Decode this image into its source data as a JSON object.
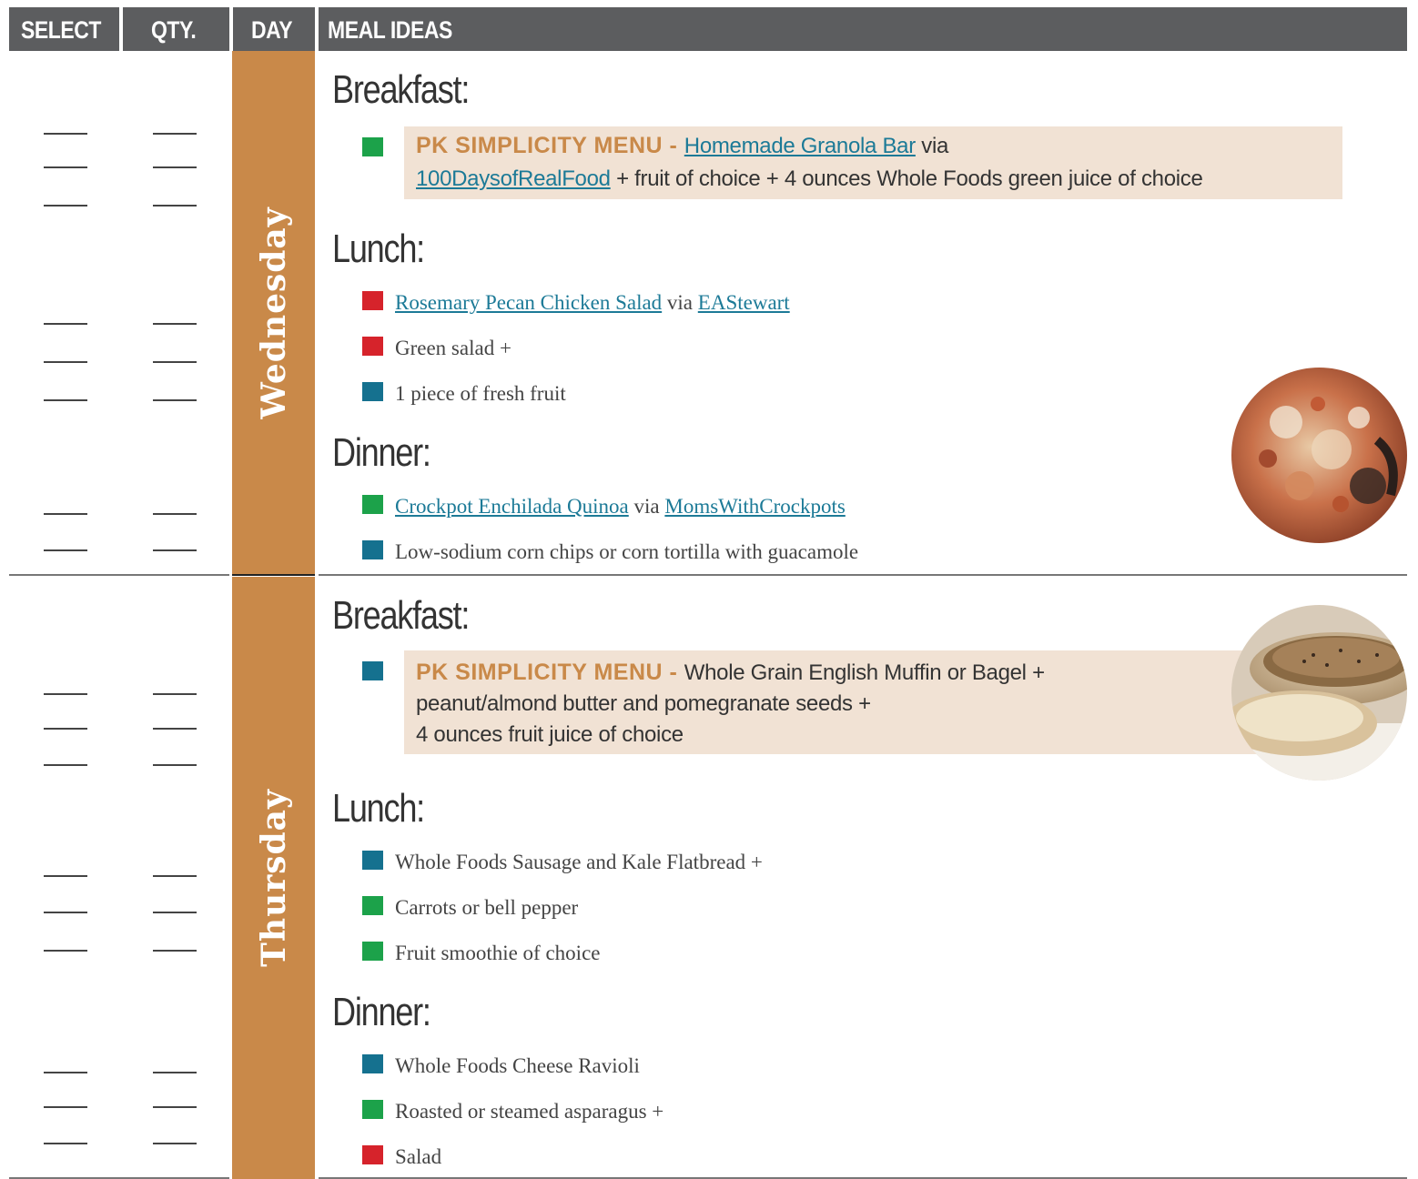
{
  "header": {
    "select": "SELECT",
    "qty": "QTY.",
    "day": "DAY",
    "meal_ideas": "MEAL IDEAS"
  },
  "days": [
    {
      "name": "Wednesday",
      "breakfast": {
        "heading": "Breakfast:",
        "pk_tag": "PK SIMPLICITY MENU",
        "pk_dash": " - ",
        "link1": "Homemade Granola Bar",
        "via": " via",
        "link2": "100DaysofRealFood",
        "rest": " + fruit of choice + 4 ounces Whole Foods green juice of choice"
      },
      "lunch": {
        "heading": "Lunch:",
        "items": [
          {
            "link": "Rosemary Pecan Chicken Salad",
            "via": " via ",
            "source": "EAStewart",
            "color": "red"
          },
          {
            "text": "Green salad +",
            "color": "red"
          },
          {
            "text": "1 piece of fresh fruit",
            "color": "blue"
          }
        ]
      },
      "dinner": {
        "heading": "Dinner:",
        "items": [
          {
            "link": "Crockpot Enchilada Quinoa",
            "via": " via ",
            "source": "MomsWithCrockpots",
            "color": "green"
          },
          {
            "text": "Low-sodium corn chips or corn tortilla with guacamole",
            "color": "blue"
          }
        ]
      }
    },
    {
      "name": "Thursday",
      "breakfast": {
        "heading": "Breakfast:",
        "pk_tag": "PK SIMPLICITY MENU",
        "pk_dash": " - ",
        "line1": "Whole Grain English Muffin or Bagel +",
        "line2": "peanut/almond butter and pomegranate seeds +",
        "line3": "4 ounces fruit juice of choice"
      },
      "lunch": {
        "heading": "Lunch:",
        "items": [
          {
            "text": "Whole Foods Sausage and Kale Flatbread +",
            "color": "blue"
          },
          {
            "text": "Carrots or bell pepper",
            "color": "green"
          },
          {
            "text": "Fruit smoothie of choice",
            "color": "green"
          }
        ]
      },
      "dinner": {
        "heading": "Dinner:",
        "items": [
          {
            "text": "Whole Foods Cheese Ravioli",
            "color": "blue"
          },
          {
            "text": "Roasted or steamed asparagus +",
            "color": "green"
          },
          {
            "text": "Salad",
            "color": "red"
          }
        ]
      }
    }
  ],
  "colors": {
    "header_bg": "#5c5d5f",
    "day_band": "#c98949",
    "pk_box": "#f1e2d4",
    "green": "#1ca24a",
    "red": "#d6232b",
    "blue": "#15718f",
    "link": "#1c7a97"
  }
}
